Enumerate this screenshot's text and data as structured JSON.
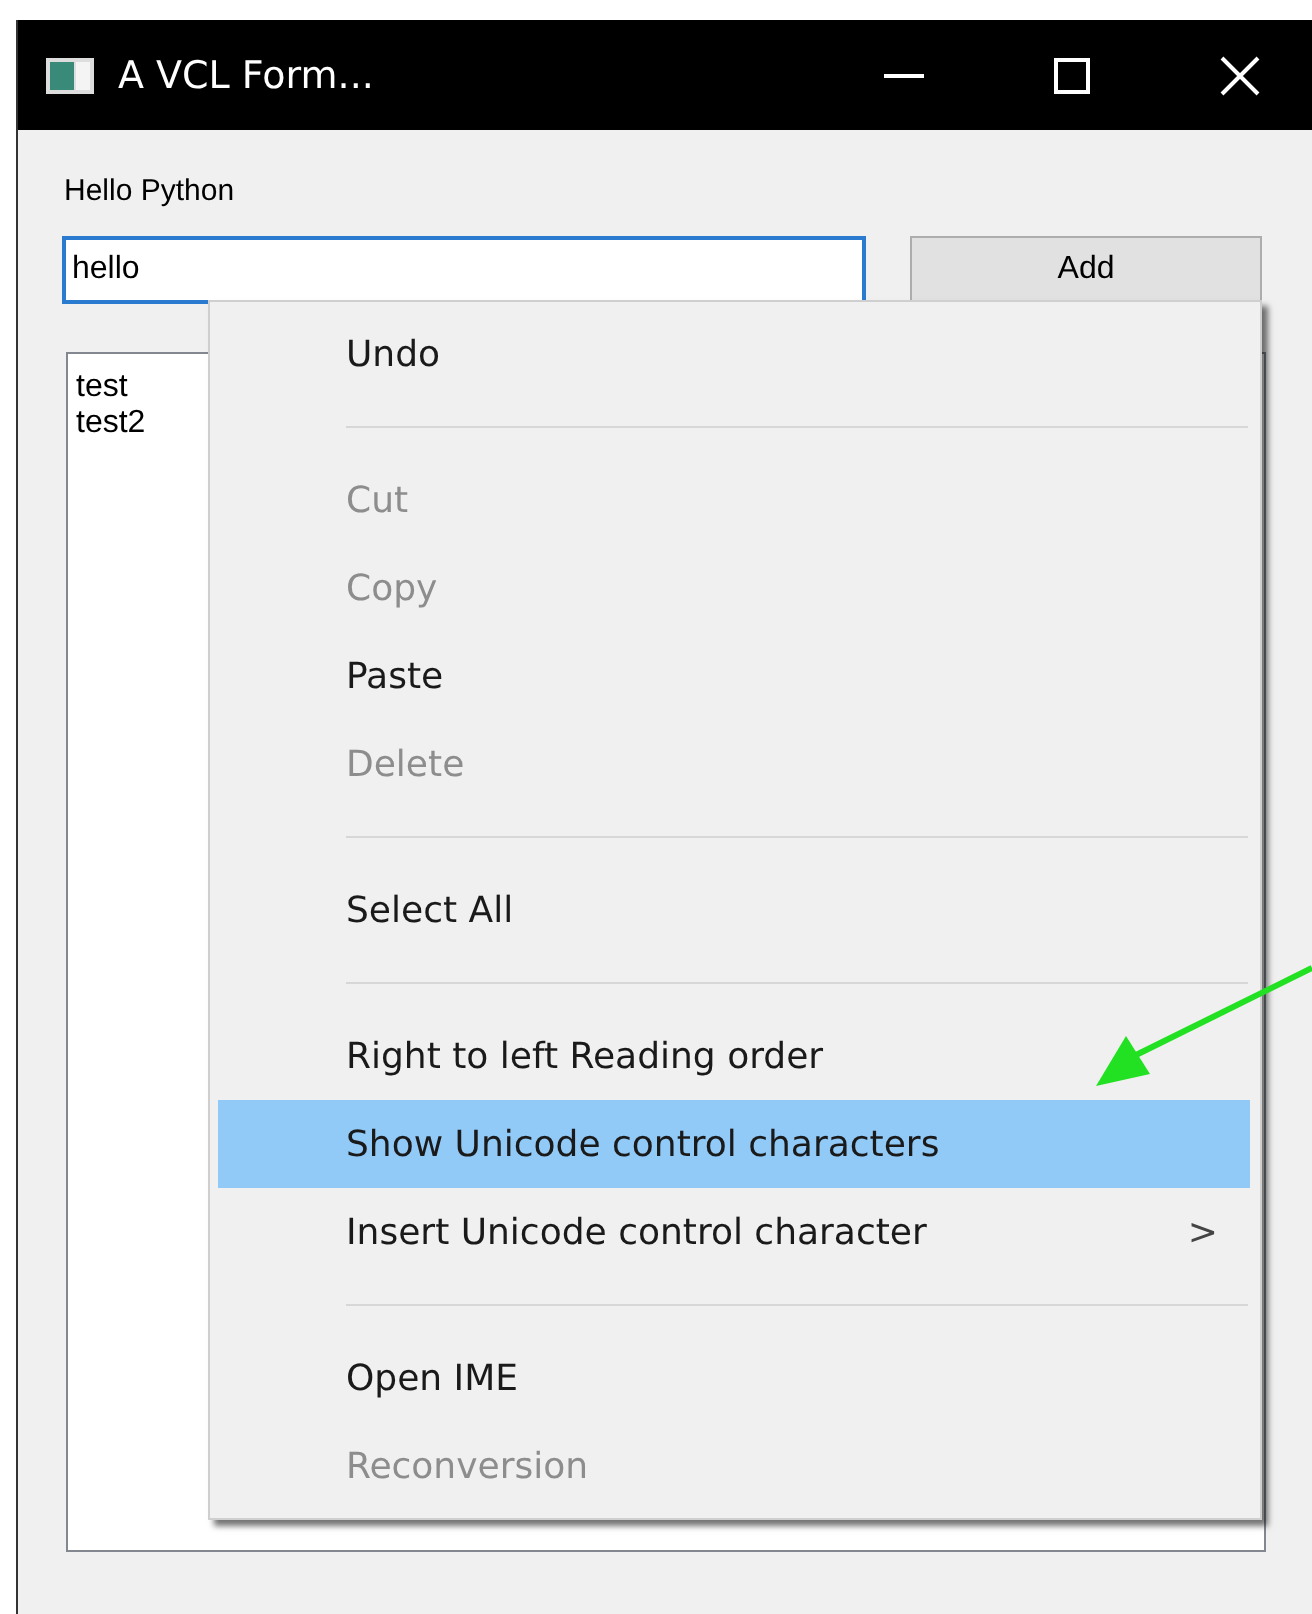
{
  "window": {
    "title": "A VCL Form..."
  },
  "label": "Hello Python",
  "edit": {
    "value": "hello"
  },
  "add_button": "Add",
  "list": [
    "test",
    "test2"
  ],
  "context_menu": [
    {
      "kind": "item",
      "label": "Undo",
      "disabled": false,
      "selected": false
    },
    {
      "kind": "separator"
    },
    {
      "kind": "item",
      "label": "Cut",
      "disabled": true,
      "selected": false
    },
    {
      "kind": "item",
      "label": "Copy",
      "disabled": true,
      "selected": false
    },
    {
      "kind": "item",
      "label": "Paste",
      "disabled": false,
      "selected": false
    },
    {
      "kind": "item",
      "label": "Delete",
      "disabled": true,
      "selected": false
    },
    {
      "kind": "separator"
    },
    {
      "kind": "item",
      "label": "Select All",
      "disabled": false,
      "selected": false
    },
    {
      "kind": "separator"
    },
    {
      "kind": "item",
      "label": "Right to left Reading order",
      "disabled": false,
      "selected": false
    },
    {
      "kind": "item",
      "label": "Show Unicode control characters",
      "disabled": false,
      "selected": true
    },
    {
      "kind": "submenu",
      "label": "Insert Unicode control character",
      "disabled": false,
      "selected": false,
      "arrow": ">"
    },
    {
      "kind": "separator"
    },
    {
      "kind": "item",
      "label": "Open IME",
      "disabled": false,
      "selected": false
    },
    {
      "kind": "item",
      "label": "Reconversion",
      "disabled": true,
      "selected": false
    }
  ]
}
